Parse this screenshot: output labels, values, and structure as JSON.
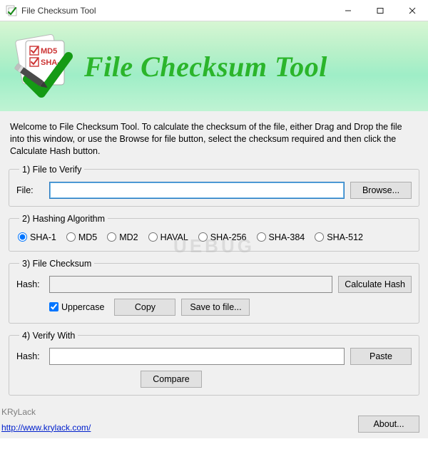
{
  "window": {
    "title": "File Checksum Tool"
  },
  "banner": {
    "badge1": "MD5",
    "badge2": "SHA-1",
    "title": "File Checksum Tool"
  },
  "intro": "Welcome to File Checksum Tool. To calculate the checksum of the file, either Drag and Drop the file into this window, or use the Browse for file button, select the checksum required and then click the Calculate Hash button.",
  "group1": {
    "legend": "1) File to Verify",
    "file_label": "File:",
    "file_value": "",
    "browse_label": "Browse..."
  },
  "group2": {
    "legend": "2) Hashing Algorithm",
    "options": [
      "SHA-1",
      "MD5",
      "MD2",
      "HAVAL",
      "SHA-256",
      "SHA-384",
      "SHA-512"
    ],
    "selected": "SHA-1"
  },
  "group3": {
    "legend": "3) File Checksum",
    "hash_label": "Hash:",
    "hash_value": "",
    "calc_label": "Calculate Hash",
    "uppercase_label": "Uppercase",
    "uppercase_checked": true,
    "copy_label": "Copy",
    "save_label": "Save to file..."
  },
  "group4": {
    "legend": "4) Verify With",
    "hash_label": "Hash:",
    "hash_value": "",
    "paste_label": "Paste",
    "compare_label": "Compare"
  },
  "footer": {
    "brand": "KRyLack",
    "url": "http://www.krylack.com/",
    "about_label": "About..."
  },
  "watermark": "UEBUG"
}
